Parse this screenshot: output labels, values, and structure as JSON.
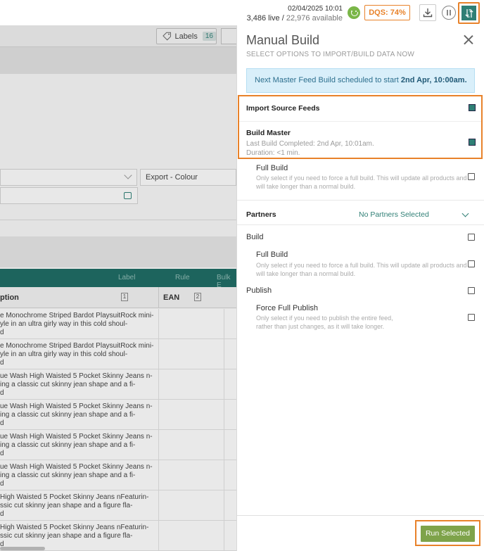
{
  "status": {
    "timestamp": "02/04/2025 10:01",
    "live_count": "3,486",
    "live_label": "live",
    "sep": "/",
    "available_count": "22,976",
    "available_label": "available",
    "dqs_label": "DQS: 74%"
  },
  "colors": {
    "teal": "#2f7f75",
    "orange": "#e8822a",
    "green_button": "#7ea34a",
    "info_bg": "#d9effa"
  },
  "background": {
    "labels_button": "Labels",
    "labels_count": "16",
    "export_select": "Export - Colour",
    "toolbar": {
      "label": "Label",
      "rule": "Rule",
      "bulk": "Bulk E"
    },
    "columns": {
      "description": "ption",
      "desc_badge": "1",
      "ean": "EAN",
      "ean_badge": "2"
    },
    "rows": [
      {
        "l1": "e Monochrome Striped Bardot PlaysuitRock mini-",
        "l2": "yle in an ultra girly way in this cold shoul-",
        "l3": "d"
      },
      {
        "l1": "e Monochrome Striped Bardot PlaysuitRock mini-",
        "l2": "yle in an ultra girly way in this cold shoul-",
        "l3": "d"
      },
      {
        "l1": "ue Wash High Waisted 5 Pocket Skinny Jeans n-",
        "l2": "ing a classic cut skinny jean shape and a fi-",
        "l3": "d"
      },
      {
        "l1": "ue Wash High Waisted 5 Pocket Skinny Jeans n-",
        "l2": "ing a classic cut skinny jean shape and a fi-",
        "l3": "d"
      },
      {
        "l1": "ue Wash High Waisted 5 Pocket Skinny Jeans n-",
        "l2": "ing a classic cut skinny jean shape and a fi-",
        "l3": "d"
      },
      {
        "l1": "ue Wash High Waisted 5 Pocket Skinny Jeans n-",
        "l2": "ing a classic cut skinny jean shape and a fi-",
        "l3": "d"
      },
      {
        "l1": "High Waisted 5 Pocket Skinny Jeans nFeaturin-",
        "l2": "ssic cut skinny jean shape and a figure fla-",
        "l3": "d"
      },
      {
        "l1": "High Waisted 5 Pocket Skinny Jeans nFeaturin-",
        "l2": "ssic cut skinny jean shape and a figure fla-",
        "l3": "d"
      }
    ]
  },
  "panel": {
    "title": "Manual Build",
    "subtitle": "SELECT OPTIONS TO IMPORT/BUILD DATA NOW",
    "info_prefix": "Next Master Feed Build scheduled to start ",
    "info_bold": "2nd Apr, 10:00am.",
    "import_source": "Import Source Feeds",
    "build_master": "Build Master",
    "last_build": "Last Build Completed: 2nd Apr, 10:01am.",
    "duration": "Duration: <1 min.",
    "full_build_1": "Full Build",
    "full_build_1_note_l1": "Only select if you need to force a full build. This will update all products and",
    "full_build_1_note_l2": "will take longer than a normal build.",
    "partners": "Partners",
    "partners_value": "No Partners Selected",
    "build": "Build",
    "full_build_2": "Full Build",
    "full_build_2_note_l1": "Only select if you need to force a full build. This will update all products and",
    "full_build_2_note_l2": "will take longer than a normal build.",
    "publish": "Publish",
    "force_publish": "Force Full Publish",
    "force_publish_note_l1": "Only select if you need to publish the entire feed,",
    "force_publish_note_l2": "rather than just changes, as it will take longer.",
    "run_button": "Run Selected"
  }
}
